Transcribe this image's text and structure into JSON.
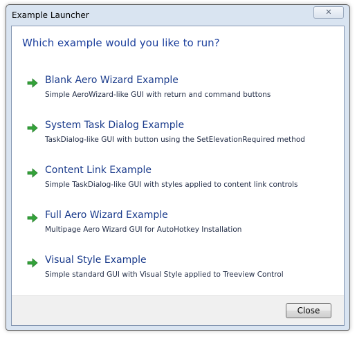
{
  "window": {
    "title": "Example Launcher",
    "close_glyph": "✕"
  },
  "heading": "Which example would you like to run?",
  "items": [
    {
      "title": "Blank Aero Wizard Example",
      "description": "Simple AeroWizard-like GUI with return and command buttons",
      "icon": "green-arrow-icon"
    },
    {
      "title": "System Task Dialog Example",
      "description": "TaskDialog-like GUI with button using the SetElevationRequired method",
      "icon": "green-arrow-icon"
    },
    {
      "title": "Content Link Example",
      "description": "Simple TaskDialog-like GUI with styles applied to content link controls",
      "icon": "green-arrow-icon"
    },
    {
      "title": "Full Aero Wizard Example",
      "description": "Multipage Aero Wizard GUI for AutoHotkey Installation",
      "icon": "green-arrow-icon"
    },
    {
      "title": "Visual Style Example",
      "description": "Simple standard GUI with Visual Style applied to Treeview Control",
      "icon": "green-arrow-icon"
    }
  ],
  "footer": {
    "close_label": "Close"
  },
  "colors": {
    "heading": "#1a3e9c",
    "link": "#1b3c8c",
    "arrow": "#2f9a2f"
  }
}
